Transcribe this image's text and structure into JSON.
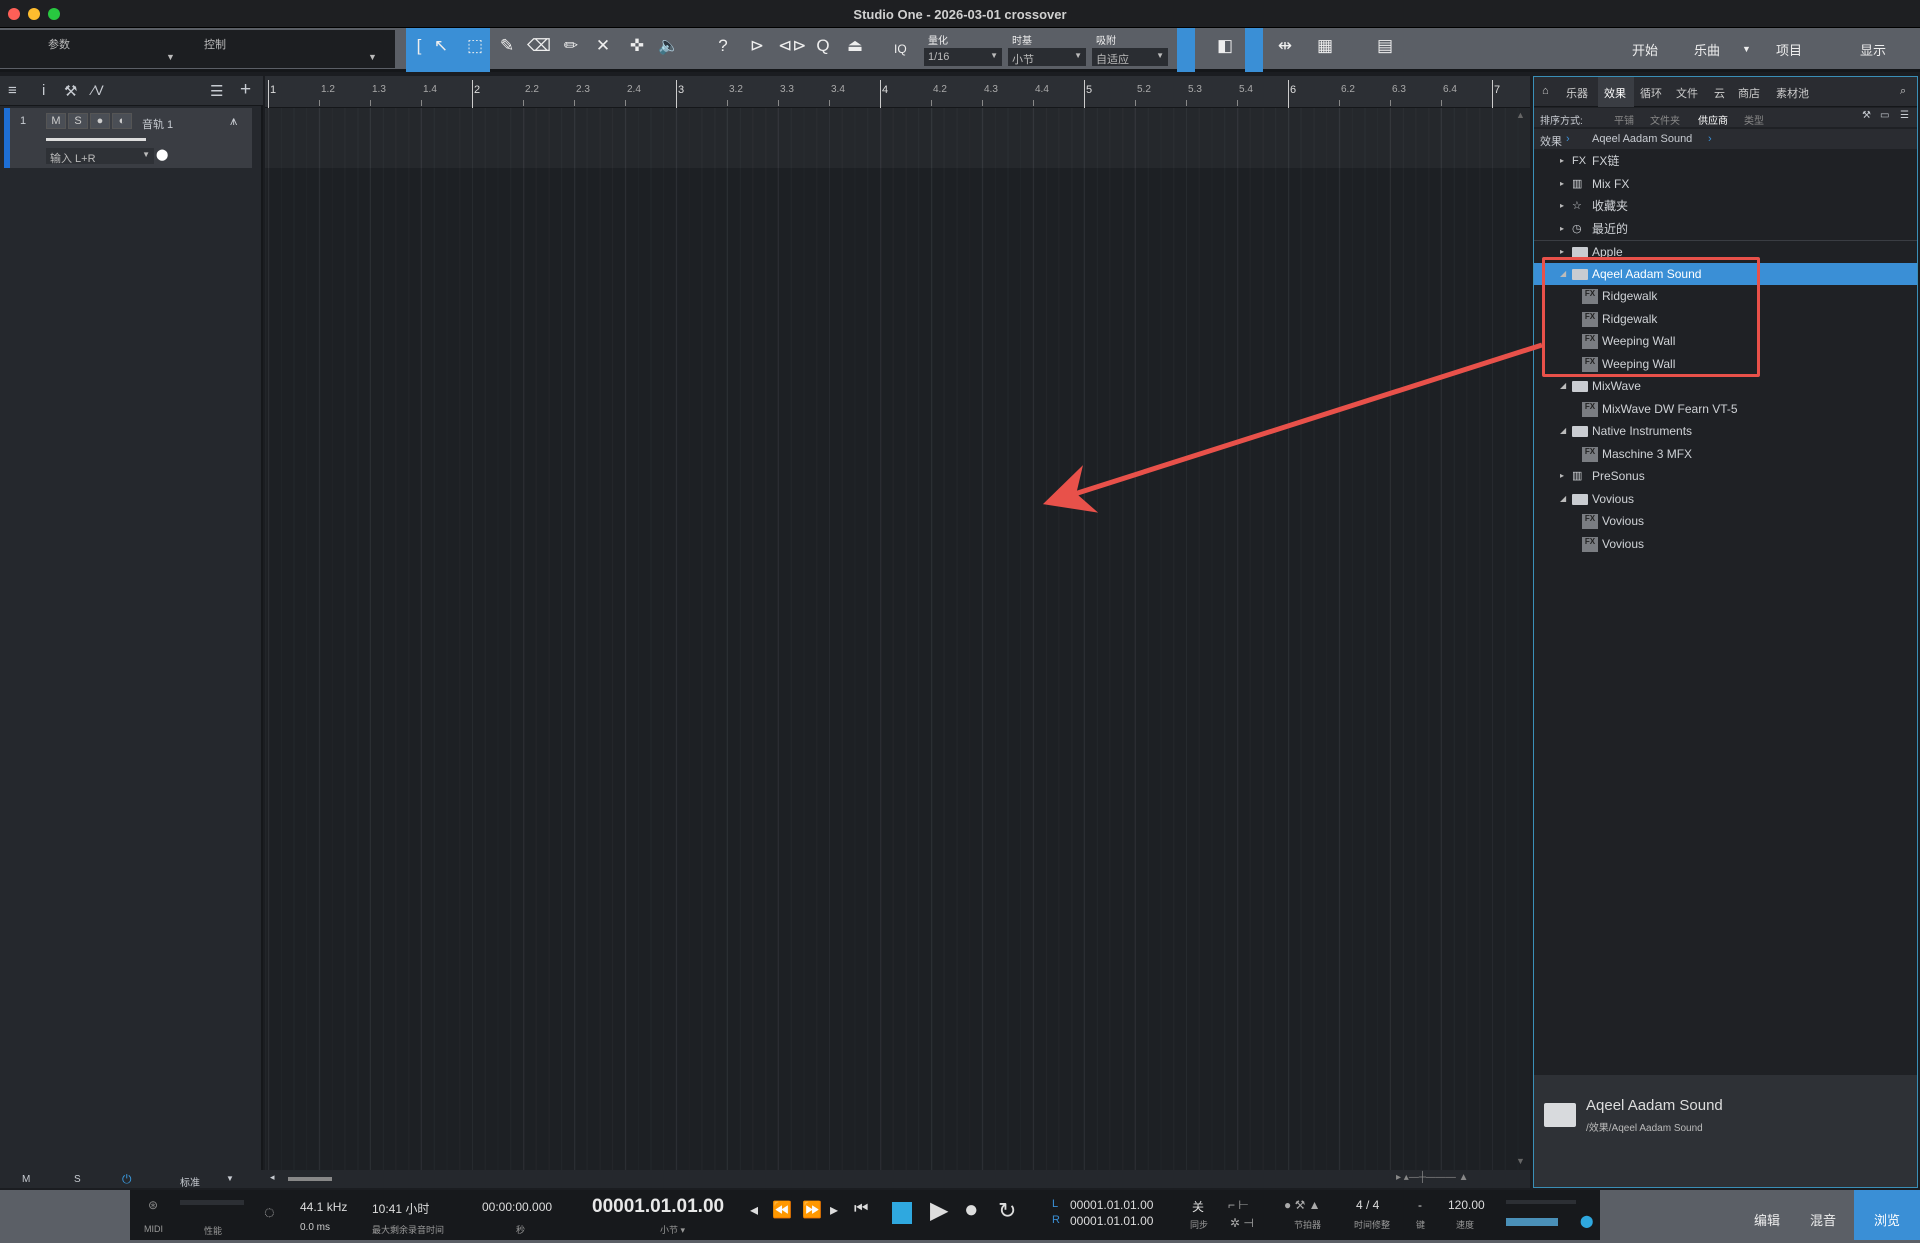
{
  "window": {
    "title": "Studio One - 2026-03-01 crossover"
  },
  "toolbar": {
    "params_label": "参数",
    "control_label": "控制",
    "quantize_label": "量化",
    "quantize_value": "1/16",
    "timebase_label": "时基",
    "timebase_value": "小节",
    "snap_label": "吸附",
    "snap_value": "自适应",
    "iq_label": "IQ",
    "nav": [
      "开始",
      "乐曲",
      "项目",
      "显示"
    ]
  },
  "trackheader": {
    "track_number": "1",
    "mute": "M",
    "solo": "S",
    "track_name": "音轨 1",
    "input": "输入 L+R"
  },
  "ruler": {
    "labels": [
      "1",
      "1.2",
      "1.3",
      "1.4",
      "2",
      "2.2",
      "2.3",
      "2.4",
      "3",
      "3.2",
      "3.3",
      "3.4",
      "4",
      "4.2",
      "4.3",
      "4.4",
      "5",
      "5.2",
      "5.3",
      "5.4",
      "6",
      "6.2",
      "6.3",
      "6.4",
      "7"
    ]
  },
  "bottombar": {
    "m": "M",
    "s": "S",
    "mode": "标准"
  },
  "browser": {
    "tabs": [
      "乐器",
      "效果",
      "循环",
      "文件",
      "云",
      "商店",
      "素材池"
    ],
    "active_tab": "效果",
    "sort_label": "排序方式:",
    "sort_options": [
      "平铺",
      "文件夹",
      "供应商",
      "类型"
    ],
    "active_sort": "供应商",
    "breadcrumb": [
      "效果",
      "Aqeel Aadam Sound"
    ],
    "items": [
      {
        "label": "FX链",
        "icon": "fx-chain-icon",
        "level": 0,
        "expand": "collapsed"
      },
      {
        "label": "Mix FX",
        "icon": "mixfx-icon",
        "level": 0,
        "expand": "collapsed"
      },
      {
        "label": "收藏夹",
        "icon": "star-icon",
        "level": 0,
        "expand": "collapsed"
      },
      {
        "label": "最近的",
        "icon": "clock-icon",
        "level": 0,
        "expand": "collapsed"
      },
      {
        "label": "Apple",
        "icon": "folder-icon",
        "level": 0,
        "expand": "collapsed"
      },
      {
        "label": "Aqeel Aadam Sound",
        "icon": "folder-open-icon",
        "level": 0,
        "expand": "expanded",
        "selected": true
      },
      {
        "label": "Ridgewalk",
        "icon": "fx-plugin-icon",
        "level": 1
      },
      {
        "label": "Ridgewalk",
        "icon": "fx-plugin-icon",
        "level": 1
      },
      {
        "label": "Weeping Wall",
        "icon": "fx-plugin-icon",
        "level": 1
      },
      {
        "label": "Weeping Wall",
        "icon": "fx-plugin-icon",
        "level": 1
      },
      {
        "label": "MixWave",
        "icon": "folder-open-icon",
        "level": 0,
        "expand": "expanded"
      },
      {
        "label": "MixWave DW Fearn VT-5",
        "icon": "fx-plugin-icon",
        "level": 1
      },
      {
        "label": "Native Instruments",
        "icon": "folder-open-icon",
        "level": 0,
        "expand": "expanded"
      },
      {
        "label": "Maschine 3 MFX",
        "icon": "fx-plugin-icon",
        "level": 1
      },
      {
        "label": "PreSonus",
        "icon": "presonus-icon",
        "level": 0,
        "expand": "collapsed"
      },
      {
        "label": "Vovious",
        "icon": "folder-open-icon",
        "level": 0,
        "expand": "expanded"
      },
      {
        "label": "Vovious",
        "icon": "fx-plugin-icon",
        "level": 1
      },
      {
        "label": "Vovious",
        "icon": "fx-plugin-icon",
        "level": 1
      }
    ],
    "info": {
      "name": "Aqeel Aadam Sound",
      "path": "/效果/Aqeel Aadam Sound"
    }
  },
  "transport": {
    "midi": "MIDI",
    "perf": "性能",
    "sample_rate": "44.1 kHz",
    "latency": "0.0 ms",
    "rec_time": "10:41 小时",
    "rec_time_label": "最大剩余录音时间",
    "seconds": "00:00:00.000",
    "seconds_label": "秒",
    "bars": "00001.01.01.00",
    "bars_label": "小节 ▾",
    "loop_l_label": "L",
    "loop_l": "00001.01.01.00",
    "loop_r_label": "R",
    "loop_r": "00001.01.01.00",
    "sync_value": "关",
    "sync_label": "同步",
    "metronome_label": "节拍器",
    "signature": "4 / 4",
    "signature_label": "时间修整",
    "key": "-",
    "key_label": "键",
    "tempo": "120.00",
    "tempo_label": "速度",
    "views": [
      "编辑",
      "混音",
      "浏览"
    ]
  },
  "colors": {
    "accent": "#3a8fd6",
    "annotation": "#e8514a"
  }
}
